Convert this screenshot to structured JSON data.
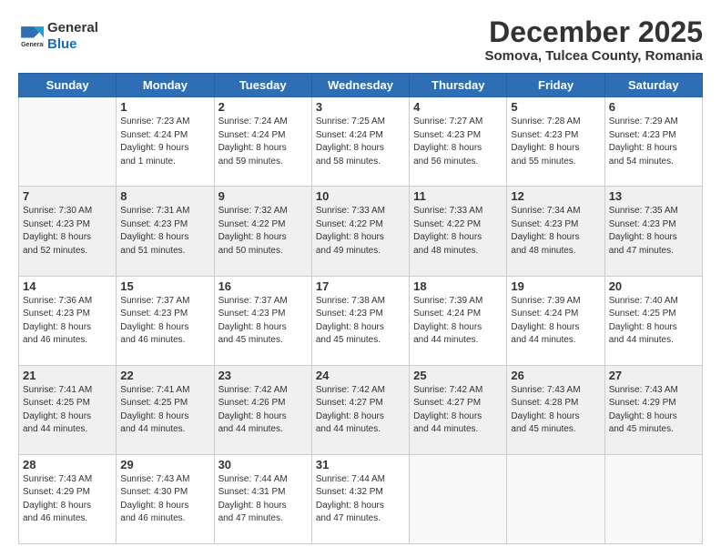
{
  "header": {
    "logo_general": "General",
    "logo_blue": "Blue",
    "month": "December 2025",
    "location": "Somova, Tulcea County, Romania"
  },
  "days_of_week": [
    "Sunday",
    "Monday",
    "Tuesday",
    "Wednesday",
    "Thursday",
    "Friday",
    "Saturday"
  ],
  "weeks": [
    [
      {
        "day": "",
        "info": ""
      },
      {
        "day": "1",
        "info": "Sunrise: 7:23 AM\nSunset: 4:24 PM\nDaylight: 9 hours\nand 1 minute."
      },
      {
        "day": "2",
        "info": "Sunrise: 7:24 AM\nSunset: 4:24 PM\nDaylight: 8 hours\nand 59 minutes."
      },
      {
        "day": "3",
        "info": "Sunrise: 7:25 AM\nSunset: 4:24 PM\nDaylight: 8 hours\nand 58 minutes."
      },
      {
        "day": "4",
        "info": "Sunrise: 7:27 AM\nSunset: 4:23 PM\nDaylight: 8 hours\nand 56 minutes."
      },
      {
        "day": "5",
        "info": "Sunrise: 7:28 AM\nSunset: 4:23 PM\nDaylight: 8 hours\nand 55 minutes."
      },
      {
        "day": "6",
        "info": "Sunrise: 7:29 AM\nSunset: 4:23 PM\nDaylight: 8 hours\nand 54 minutes."
      }
    ],
    [
      {
        "day": "7",
        "info": "Sunrise: 7:30 AM\nSunset: 4:23 PM\nDaylight: 8 hours\nand 52 minutes."
      },
      {
        "day": "8",
        "info": "Sunrise: 7:31 AM\nSunset: 4:23 PM\nDaylight: 8 hours\nand 51 minutes."
      },
      {
        "day": "9",
        "info": "Sunrise: 7:32 AM\nSunset: 4:22 PM\nDaylight: 8 hours\nand 50 minutes."
      },
      {
        "day": "10",
        "info": "Sunrise: 7:33 AM\nSunset: 4:22 PM\nDaylight: 8 hours\nand 49 minutes."
      },
      {
        "day": "11",
        "info": "Sunrise: 7:33 AM\nSunset: 4:22 PM\nDaylight: 8 hours\nand 48 minutes."
      },
      {
        "day": "12",
        "info": "Sunrise: 7:34 AM\nSunset: 4:23 PM\nDaylight: 8 hours\nand 48 minutes."
      },
      {
        "day": "13",
        "info": "Sunrise: 7:35 AM\nSunset: 4:23 PM\nDaylight: 8 hours\nand 47 minutes."
      }
    ],
    [
      {
        "day": "14",
        "info": "Sunrise: 7:36 AM\nSunset: 4:23 PM\nDaylight: 8 hours\nand 46 minutes."
      },
      {
        "day": "15",
        "info": "Sunrise: 7:37 AM\nSunset: 4:23 PM\nDaylight: 8 hours\nand 46 minutes."
      },
      {
        "day": "16",
        "info": "Sunrise: 7:37 AM\nSunset: 4:23 PM\nDaylight: 8 hours\nand 45 minutes."
      },
      {
        "day": "17",
        "info": "Sunrise: 7:38 AM\nSunset: 4:23 PM\nDaylight: 8 hours\nand 45 minutes."
      },
      {
        "day": "18",
        "info": "Sunrise: 7:39 AM\nSunset: 4:24 PM\nDaylight: 8 hours\nand 44 minutes."
      },
      {
        "day": "19",
        "info": "Sunrise: 7:39 AM\nSunset: 4:24 PM\nDaylight: 8 hours\nand 44 minutes."
      },
      {
        "day": "20",
        "info": "Sunrise: 7:40 AM\nSunset: 4:25 PM\nDaylight: 8 hours\nand 44 minutes."
      }
    ],
    [
      {
        "day": "21",
        "info": "Sunrise: 7:41 AM\nSunset: 4:25 PM\nDaylight: 8 hours\nand 44 minutes."
      },
      {
        "day": "22",
        "info": "Sunrise: 7:41 AM\nSunset: 4:25 PM\nDaylight: 8 hours\nand 44 minutes."
      },
      {
        "day": "23",
        "info": "Sunrise: 7:42 AM\nSunset: 4:26 PM\nDaylight: 8 hours\nand 44 minutes."
      },
      {
        "day": "24",
        "info": "Sunrise: 7:42 AM\nSunset: 4:27 PM\nDaylight: 8 hours\nand 44 minutes."
      },
      {
        "day": "25",
        "info": "Sunrise: 7:42 AM\nSunset: 4:27 PM\nDaylight: 8 hours\nand 44 minutes."
      },
      {
        "day": "26",
        "info": "Sunrise: 7:43 AM\nSunset: 4:28 PM\nDaylight: 8 hours\nand 45 minutes."
      },
      {
        "day": "27",
        "info": "Sunrise: 7:43 AM\nSunset: 4:29 PM\nDaylight: 8 hours\nand 45 minutes."
      }
    ],
    [
      {
        "day": "28",
        "info": "Sunrise: 7:43 AM\nSunset: 4:29 PM\nDaylight: 8 hours\nand 46 minutes."
      },
      {
        "day": "29",
        "info": "Sunrise: 7:43 AM\nSunset: 4:30 PM\nDaylight: 8 hours\nand 46 minutes."
      },
      {
        "day": "30",
        "info": "Sunrise: 7:44 AM\nSunset: 4:31 PM\nDaylight: 8 hours\nand 47 minutes."
      },
      {
        "day": "31",
        "info": "Sunrise: 7:44 AM\nSunset: 4:32 PM\nDaylight: 8 hours\nand 47 minutes."
      },
      {
        "day": "",
        "info": ""
      },
      {
        "day": "",
        "info": ""
      },
      {
        "day": "",
        "info": ""
      }
    ]
  ]
}
